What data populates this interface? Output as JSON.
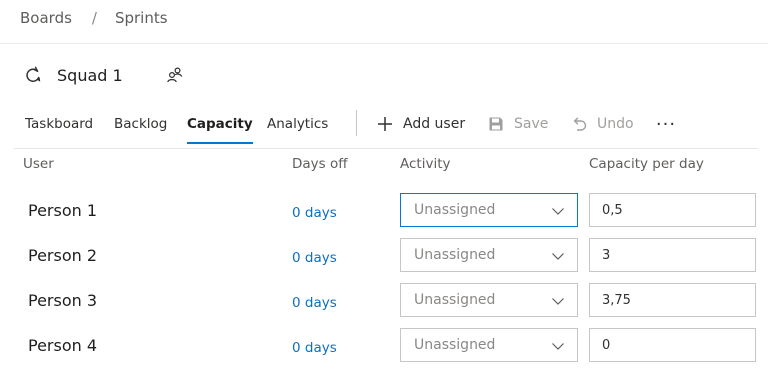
{
  "breadcrumb": {
    "items": [
      "Boards",
      "Sprints"
    ],
    "separator": "/"
  },
  "team": {
    "name": "Squad 1",
    "icon": "sprint-icon",
    "people_icon": "people-icon"
  },
  "tabs": [
    {
      "label": "Taskboard",
      "active": false
    },
    {
      "label": "Backlog",
      "active": false
    },
    {
      "label": "Capacity",
      "active": true
    },
    {
      "label": "Analytics",
      "active": false
    }
  ],
  "commands": {
    "add_user": {
      "label": "Add user",
      "icon": "plus-icon",
      "enabled": true
    },
    "save": {
      "label": "Save",
      "icon": "save-icon",
      "enabled": false
    },
    "undo": {
      "label": "Undo",
      "icon": "undo-icon",
      "enabled": false
    },
    "more": {
      "label": "···",
      "icon": "more-icon"
    }
  },
  "columns": {
    "user": "User",
    "days_off": "Days off",
    "activity": "Activity",
    "capacity": "Capacity per day"
  },
  "rows": [
    {
      "user": "Person 1",
      "days_off": "0 days",
      "activity": "Unassigned",
      "capacity": "0,5",
      "focused": true
    },
    {
      "user": "Person 2",
      "days_off": "0 days",
      "activity": "Unassigned",
      "capacity": "3",
      "focused": false
    },
    {
      "user": "Person 3",
      "days_off": "0 days",
      "activity": "Unassigned",
      "capacity": "3,75",
      "focused": false
    },
    {
      "user": "Person 4",
      "days_off": "0 days",
      "activity": "Unassigned",
      "capacity": "0",
      "focused": false
    }
  ],
  "colors": {
    "accent": "#0078d4",
    "link": "#106ebe",
    "text": "#201f1e",
    "muted": "#605e5c",
    "disabled": "#a19f9d",
    "border": "#c8c6c4"
  }
}
